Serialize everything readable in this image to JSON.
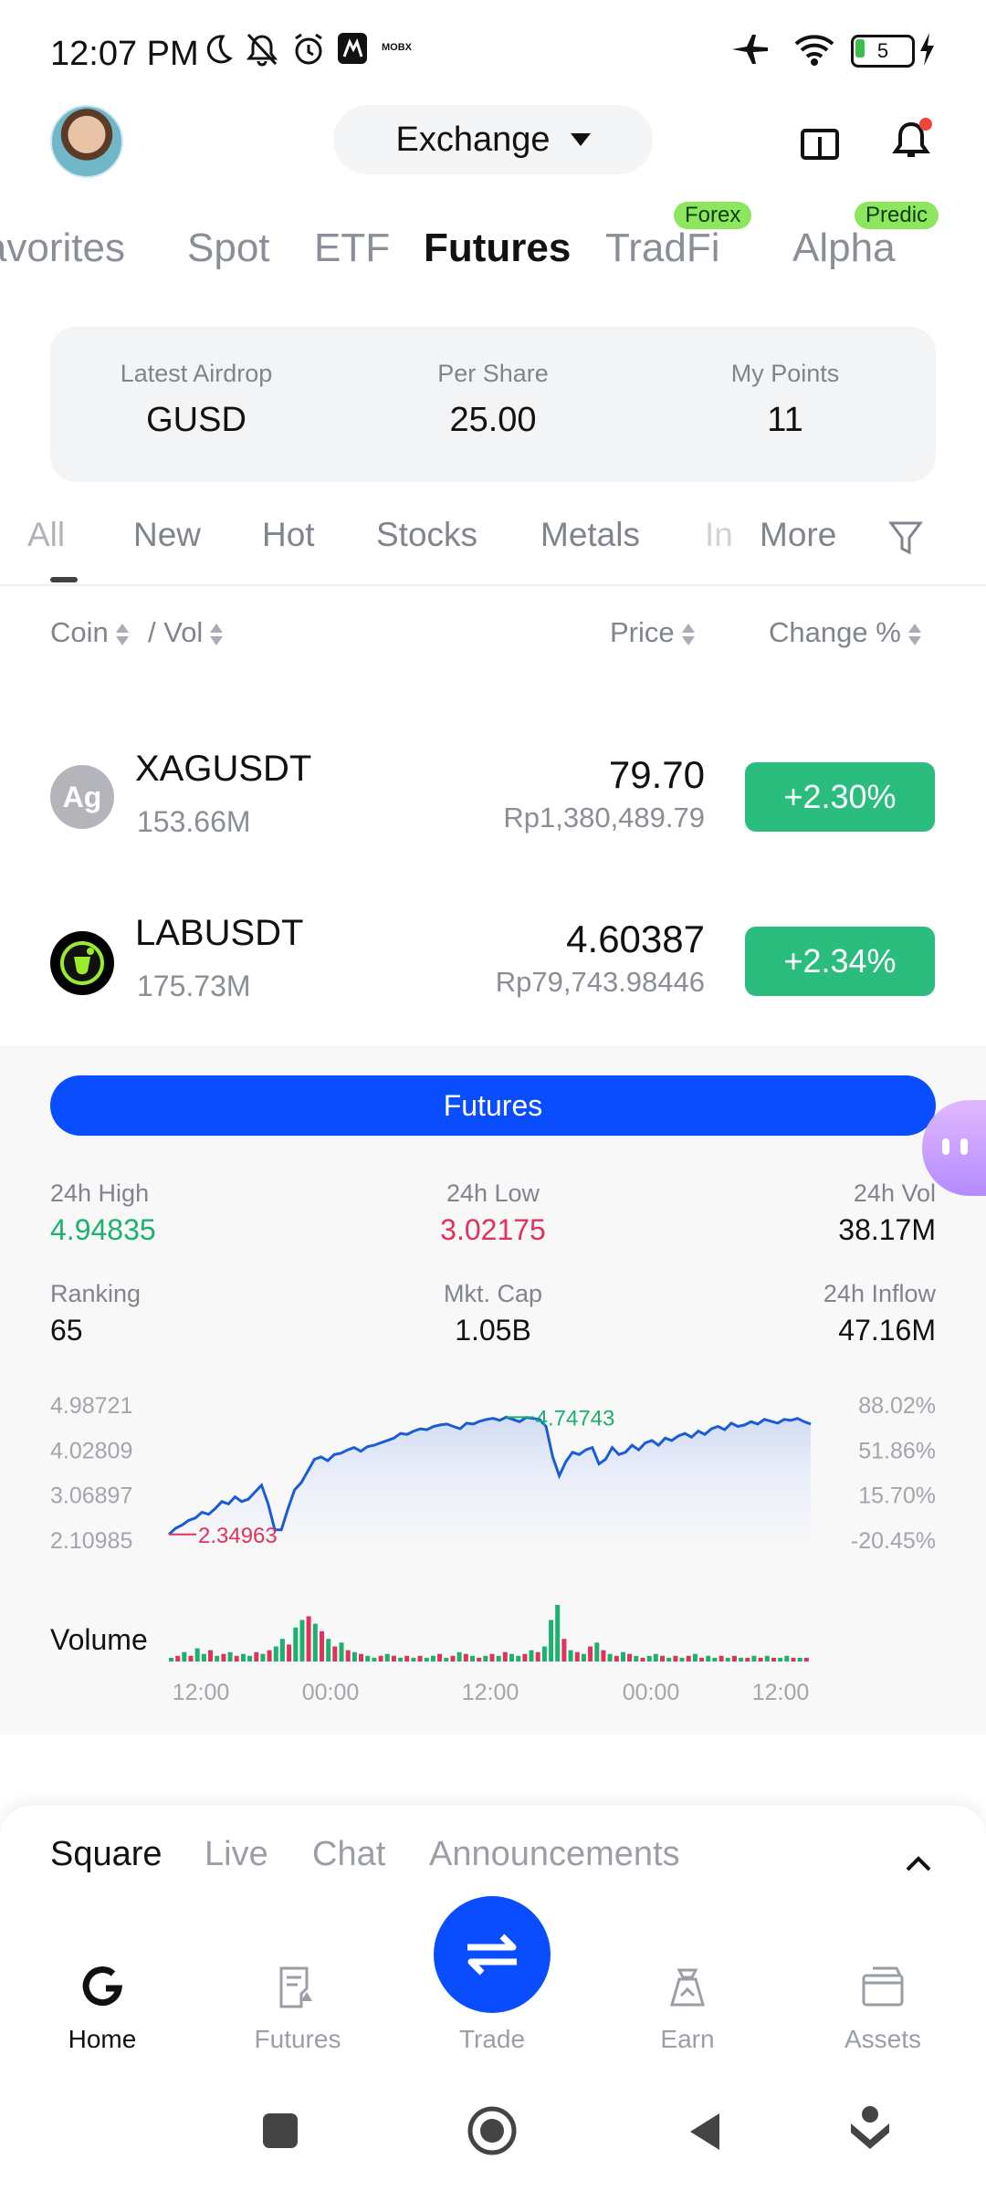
{
  "status_bar": {
    "time": "12:07 PM",
    "battery": "5",
    "carrier_badge": "MOBX"
  },
  "header": {
    "exchange_label": "Exchange"
  },
  "top_tabs": {
    "items": [
      {
        "label": "Favorites"
      },
      {
        "label": "Spot"
      },
      {
        "label": "ETF"
      },
      {
        "label": "Futures"
      },
      {
        "label": "TradFi"
      },
      {
        "label": "Alpha"
      }
    ],
    "badges": {
      "tradfi": "Forex",
      "alpha": "Predic"
    },
    "active": "Futures"
  },
  "airdrop_card": {
    "latest_airdrop_label": "Latest Airdrop",
    "latest_airdrop_value": "GUSD",
    "per_share_label": "Per Share",
    "per_share_value": "25.00",
    "my_points_label": "My Points",
    "my_points_value": "11"
  },
  "categories": {
    "items": [
      "All",
      "New",
      "Hot",
      "Stocks",
      "Metals",
      "In"
    ],
    "more_label": "More"
  },
  "columns": {
    "coin": "Coin",
    "vol": "/ Vol",
    "price": "Price",
    "change": "Change %"
  },
  "rows": [
    {
      "symbol": "XAGUSDT",
      "icon_text": "Ag",
      "volume": "153.66M",
      "price": "79.70",
      "fiat": "Rp1,380,489.79",
      "change": "+2.30%"
    },
    {
      "symbol": "LABUSDT",
      "volume": "175.73M",
      "price": "4.60387",
      "fiat": "Rp79,743.98446",
      "change": "+2.34%"
    }
  ],
  "detail": {
    "futures_button": "Futures",
    "high_label": "24h High",
    "high_value": "4.94835",
    "low_label": "24h Low",
    "low_value": "3.02175",
    "vol_label": "24h Vol",
    "vol_value": "38.17M",
    "rank_label": "Ranking",
    "rank_value": "65",
    "cap_label": "Mkt. Cap",
    "cap_value": "1.05B",
    "inflow_label": "24h Inflow",
    "inflow_value": "47.16M",
    "volume_label": "Volume"
  },
  "chart_data": {
    "type": "area",
    "title": "",
    "y_ticks_left": [
      "4.98721",
      "4.02809",
      "3.06897",
      "2.10985"
    ],
    "y_ticks_right": [
      "88.02%",
      "51.86%",
      "15.70%",
      "-20.45%"
    ],
    "x_ticks": [
      "12:00",
      "00:00",
      "12:00",
      "00:00",
      "12:00"
    ],
    "ylim": [
      2.10985,
      4.98721
    ],
    "annotations": {
      "max": "4.74743",
      "min": "2.34963"
    },
    "series": [
      {
        "values": [
          2.25,
          2.38,
          2.45,
          2.55,
          2.6,
          2.72,
          2.68,
          2.8,
          2.95,
          2.9,
          3.05,
          2.95,
          3.0,
          3.15,
          3.3,
          2.9,
          2.35,
          2.34963,
          2.8,
          3.2,
          3.35,
          3.6,
          3.85,
          3.9,
          3.82,
          3.95,
          3.98,
          4.05,
          4.1,
          4.02,
          4.12,
          4.15,
          4.2,
          4.25,
          4.3,
          4.4,
          4.38,
          4.45,
          4.5,
          4.48,
          4.55,
          4.58,
          4.6,
          4.55,
          4.5,
          4.62,
          4.6,
          4.66,
          4.7,
          4.72,
          4.68,
          4.74743,
          4.7,
          4.65,
          4.74,
          4.72,
          4.7,
          4.55,
          3.9,
          3.5,
          3.8,
          4.0,
          3.95,
          4.05,
          4.1,
          3.75,
          3.85,
          4.1,
          3.95,
          4.0,
          4.15,
          4.05,
          4.2,
          4.25,
          4.15,
          4.3,
          4.25,
          4.35,
          4.4,
          4.32,
          4.45,
          4.38,
          4.5,
          4.55,
          4.48,
          4.62,
          4.55,
          4.58,
          4.65,
          4.6,
          4.7,
          4.66,
          4.62,
          4.7,
          4.68,
          4.72,
          4.65,
          4.6
        ]
      }
    ],
    "volume": [
      2,
      3,
      5,
      3,
      7,
      4,
      6,
      3,
      4,
      5,
      3,
      4,
      3,
      5,
      4,
      6,
      8,
      12,
      9,
      18,
      22,
      24,
      20,
      16,
      12,
      8,
      10,
      6,
      5,
      4,
      3,
      2,
      3,
      4,
      3,
      2,
      3,
      2,
      3,
      2,
      3,
      4,
      2,
      3,
      5,
      4,
      3,
      2,
      3,
      4,
      3,
      5,
      4,
      3,
      4,
      6,
      5,
      8,
      22,
      30,
      12,
      6,
      5,
      4,
      8,
      10,
      6,
      4,
      3,
      5,
      4,
      3,
      2,
      3,
      4,
      3,
      2,
      3,
      2,
      3,
      4,
      2,
      3,
      2,
      3,
      2,
      3,
      2,
      2,
      3,
      2,
      3,
      2,
      2,
      3,
      2,
      2,
      2
    ],
    "volume_up": [
      1,
      0,
      1,
      0,
      1,
      1,
      0,
      1,
      0,
      1,
      0,
      1,
      1,
      0,
      1,
      0,
      1,
      1,
      0,
      1,
      1,
      0,
      1,
      0,
      1,
      0,
      1,
      0,
      1,
      0,
      1,
      1,
      0,
      1,
      0,
      1,
      0,
      1,
      0,
      1,
      1,
      0,
      1,
      0,
      1,
      0,
      1,
      0,
      1,
      0,
      1,
      0,
      1,
      1,
      0,
      1,
      0,
      1,
      1,
      1,
      0,
      1,
      0,
      1,
      0,
      1,
      0,
      1,
      0,
      1,
      0,
      1,
      0,
      1,
      1,
      0,
      1,
      0,
      1,
      0,
      1,
      0,
      1,
      1,
      0,
      1,
      0,
      1,
      0,
      1,
      0,
      1,
      0,
      1,
      1,
      0,
      1,
      0
    ],
    "colors": {
      "line": "#1a5bd6",
      "up": "#1cb16f",
      "down": "#e0325c"
    }
  },
  "bottom_tabs": {
    "items": [
      "Square",
      "Live",
      "Chat",
      "Announcements"
    ],
    "active": "Square"
  },
  "nav": {
    "items": [
      "Home",
      "Futures",
      "Trade",
      "Earn",
      "Assets"
    ],
    "active": "Home"
  }
}
